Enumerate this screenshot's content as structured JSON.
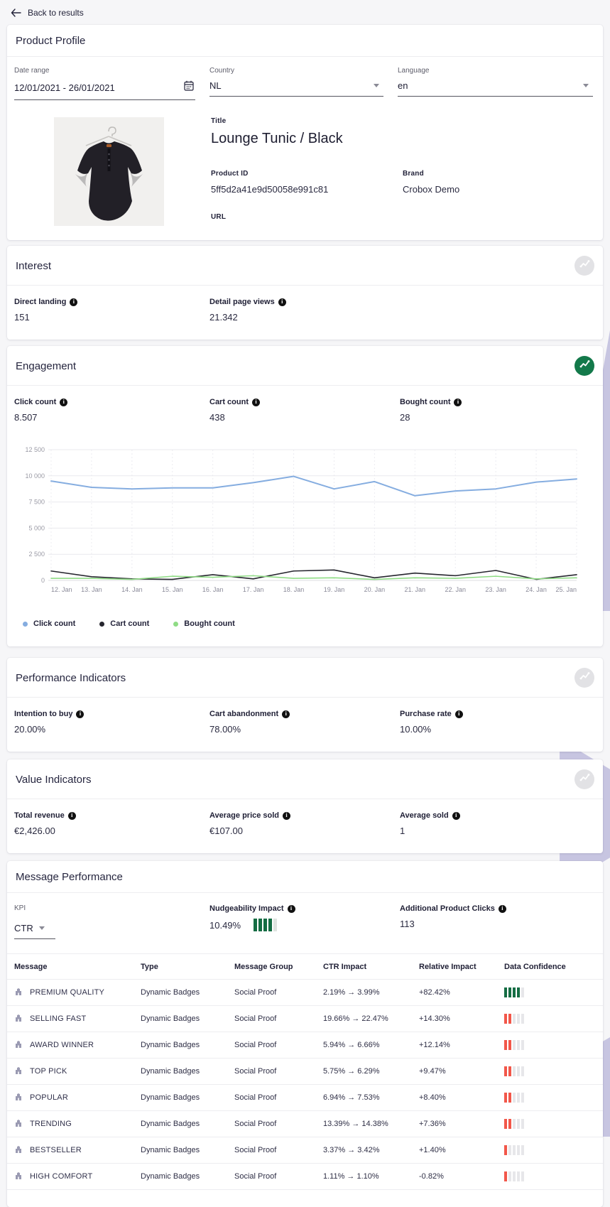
{
  "colors": {
    "accent_green": "#13794a",
    "deco_purple": "#c7c5e1",
    "bar_green": "#156d44",
    "bar_red": "#f2574a",
    "bar_empty": "#e7e7ea",
    "nudge_bar_empty": "#dfe3e0"
  },
  "topbar": {
    "back_label": "Back to results"
  },
  "product_profile": {
    "title": "Product Profile",
    "filters": {
      "date_range": {
        "label": "Date range",
        "value": "12/01/2021 - 26/01/2021"
      },
      "country": {
        "label": "Country",
        "value": "NL"
      },
      "language": {
        "label": "Language",
        "value": "en"
      }
    },
    "product": {
      "title_label": "Title",
      "title": "Lounge Tunic / Black",
      "product_id_label": "Product ID",
      "product_id": "5ff5d2a41e9d50058e991c81",
      "brand_label": "Brand",
      "brand": "Crobox Demo",
      "url_label": "URL",
      "url": ""
    }
  },
  "interest": {
    "title": "Interest",
    "stats": [
      {
        "label": "Direct landing",
        "value": "151"
      },
      {
        "label": "Detail page views",
        "value": "21.342"
      }
    ]
  },
  "engagement": {
    "title": "Engagement",
    "stats": [
      {
        "label": "Click count",
        "value": "8.507"
      },
      {
        "label": "Cart count",
        "value": "438"
      },
      {
        "label": "Bought count",
        "value": "28"
      }
    ]
  },
  "chart_data": {
    "type": "line",
    "categories": [
      "12. Jan",
      "13. Jan",
      "14. Jan",
      "15. Jan",
      "16. Jan",
      "17. Jan",
      "18. Jan",
      "19. Jan",
      "20. Jan",
      "21. Jan",
      "22. Jan",
      "23. Jan",
      "24. Jan",
      "25. Jan"
    ],
    "series": [
      {
        "name": "Click count",
        "color": "#85ade0",
        "width": 2,
        "values": [
          9500,
          8900,
          8750,
          8850,
          8850,
          9350,
          9950,
          8750,
          9450,
          8100,
          8550,
          8750,
          9400,
          9700
        ]
      },
      {
        "name": "Cart count",
        "color": "#26262e",
        "width": 1.6,
        "values": [
          900,
          350,
          150,
          100,
          550,
          150,
          900,
          1000,
          250,
          700,
          450,
          950,
          100,
          550
        ]
      },
      {
        "name": "Bought count",
        "color": "#8fdc85",
        "width": 1.6,
        "values": [
          200,
          200,
          100,
          400,
          300,
          450,
          200,
          250,
          100,
          250,
          200,
          400,
          150,
          250
        ]
      }
    ],
    "ylim": [
      0,
      12500
    ],
    "yticks": [
      0,
      2500,
      5000,
      7500,
      10000,
      12500
    ],
    "ytick_labels": [
      "0",
      "2 500",
      "5 000",
      "7 500",
      "10 000",
      "12 500"
    ],
    "grid": true,
    "legend_position": "bottom",
    "title": "",
    "xlabel": "",
    "ylabel": ""
  },
  "performance_indicators": {
    "title": "Performance Indicators",
    "stats": [
      {
        "label": "Intention to buy",
        "value": "20.00%"
      },
      {
        "label": "Cart abandonment",
        "value": "78.00%"
      },
      {
        "label": "Purchase rate",
        "value": "10.00%"
      }
    ]
  },
  "value_indicators": {
    "title": "Value Indicators",
    "stats": [
      {
        "label": "Total revenue",
        "value": "€2,426.00"
      },
      {
        "label": "Average price sold",
        "value": "€107.00"
      },
      {
        "label": "Average sold",
        "value": "1"
      }
    ]
  },
  "message_performance": {
    "title": "Message Performance",
    "kpi": {
      "label": "KPI",
      "value": "CTR"
    },
    "nudgeability": {
      "label": "Nudgeability Impact",
      "value": "10.49%",
      "bars_filled": 4,
      "bars_total": 5
    },
    "additional_clicks": {
      "label": "Additional Product Clicks",
      "value": "113"
    },
    "table": {
      "columns": [
        "Message",
        "Type",
        "Message Group",
        "CTR Impact",
        "Relative Impact",
        "Data Confidence"
      ],
      "rows": [
        {
          "message": "PREMIUM QUALITY",
          "type": "Dynamic Badges",
          "group": "Social Proof",
          "ctr_impact": "2.19% → 3.99%",
          "relative_impact": "+82.42%",
          "confidence": 4,
          "confidence_color": "green"
        },
        {
          "message": "SELLING FAST",
          "type": "Dynamic Badges",
          "group": "Social Proof",
          "ctr_impact": "19.66% → 22.47%",
          "relative_impact": "+14.30%",
          "confidence": 2,
          "confidence_color": "red"
        },
        {
          "message": "AWARD WINNER",
          "type": "Dynamic Badges",
          "group": "Social Proof",
          "ctr_impact": "5.94% → 6.66%",
          "relative_impact": "+12.14%",
          "confidence": 2,
          "confidence_color": "red"
        },
        {
          "message": "TOP PICK",
          "type": "Dynamic Badges",
          "group": "Social Proof",
          "ctr_impact": "5.75% → 6.29%",
          "relative_impact": "+9.47%",
          "confidence": 2,
          "confidence_color": "red"
        },
        {
          "message": "POPULAR",
          "type": "Dynamic Badges",
          "group": "Social Proof",
          "ctr_impact": "6.94% → 7.53%",
          "relative_impact": "+8.40%",
          "confidence": 2,
          "confidence_color": "red"
        },
        {
          "message": "TRENDING",
          "type": "Dynamic Badges",
          "group": "Social Proof",
          "ctr_impact": "13.39% → 14.38%",
          "relative_impact": "+7.36%",
          "confidence": 2,
          "confidence_color": "red"
        },
        {
          "message": "BESTSELLER",
          "type": "Dynamic Badges",
          "group": "Social Proof",
          "ctr_impact": "3.37% → 3.42%",
          "relative_impact": "+1.40%",
          "confidence": 1,
          "confidence_color": "red"
        },
        {
          "message": "HIGH COMFORT",
          "type": "Dynamic Badges",
          "group": "Social Proof",
          "ctr_impact": "1.11% → 1.10%",
          "relative_impact": "-0.82%",
          "confidence": 1,
          "confidence_color": "red"
        }
      ]
    }
  }
}
